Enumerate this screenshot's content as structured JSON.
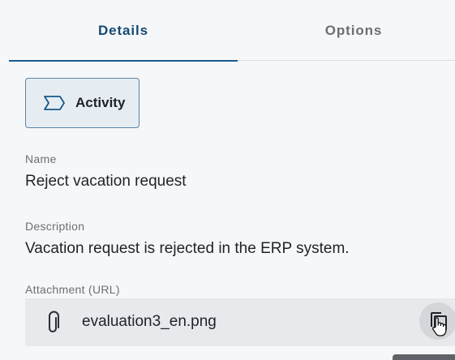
{
  "tabs": [
    {
      "label": "Details",
      "active": true
    },
    {
      "label": "Options",
      "active": false
    }
  ],
  "type_chip": {
    "label": "Activity",
    "icon": "activity-shape-icon"
  },
  "fields": {
    "name": {
      "label": "Name",
      "value": "Reject vacation request"
    },
    "description": {
      "label": "Description",
      "value": "Vacation request is rejected in the ERP system."
    },
    "attachment": {
      "label": "Attachment (URL)",
      "value": "evaluation3_en.png",
      "icon": "paperclip-icon",
      "action_icon": "copy-icon"
    }
  },
  "colors": {
    "accent": "#175a8a",
    "chip_background": "#e6edf2",
    "chip_border": "#5c83a6"
  }
}
